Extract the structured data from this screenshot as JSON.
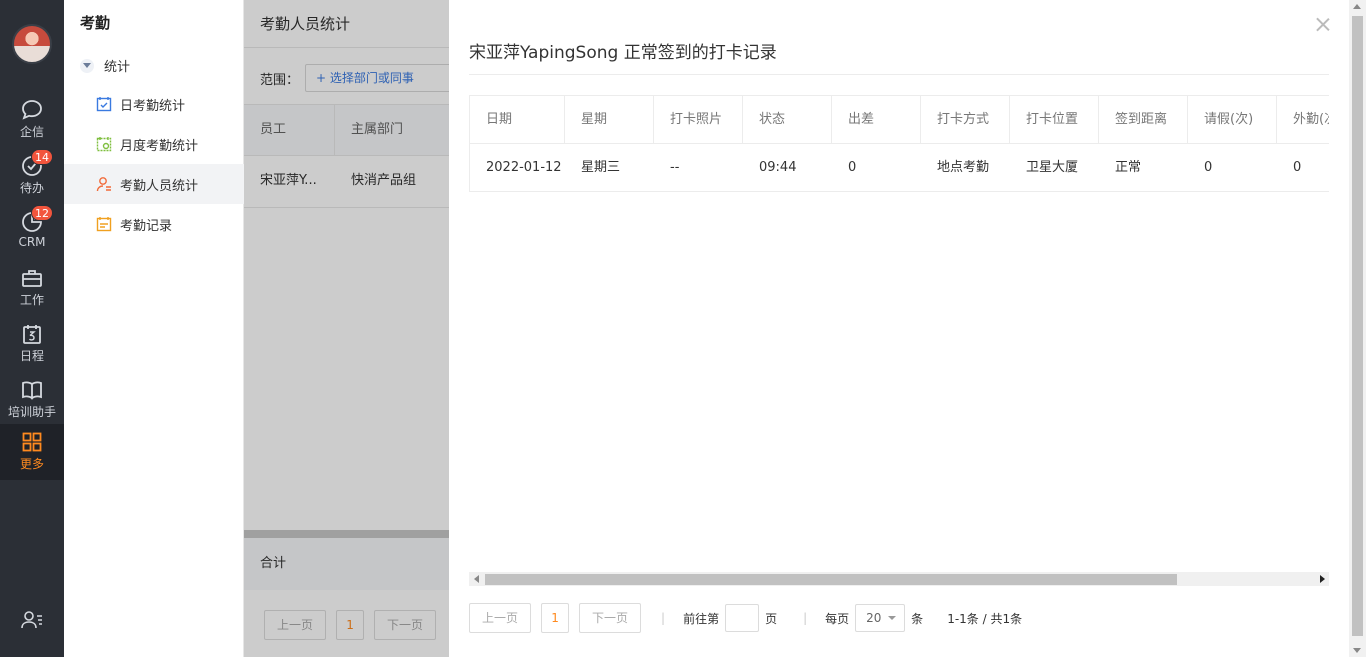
{
  "rail": {
    "items": [
      {
        "label": "企信"
      },
      {
        "label": "待办",
        "badge": "14"
      },
      {
        "label": "CRM",
        "badge": "12"
      },
      {
        "label": "工作"
      },
      {
        "label": "日程"
      },
      {
        "label": "培训助手"
      },
      {
        "label": "更多"
      }
    ]
  },
  "sidebar": {
    "title": "考勤",
    "group": "统计",
    "items": [
      {
        "label": "日考勤统计",
        "icon": "calendar-check-icon"
      },
      {
        "label": "月度考勤统计",
        "icon": "calendar-month-icon"
      },
      {
        "label": "考勤人员统计",
        "icon": "person-icon"
      },
      {
        "label": "考勤记录",
        "icon": "record-icon"
      }
    ]
  },
  "background": {
    "header": "考勤人员统计",
    "range_label": "范围：",
    "range_picker": "+ 选择部门或同事",
    "columns": [
      "员工",
      "主属部门"
    ],
    "row": [
      "宋亚萍Y...",
      "快消产品组"
    ],
    "total_label": "合计",
    "pager": {
      "prev": "上一页",
      "page": "1",
      "next": "下一页"
    }
  },
  "drawer": {
    "title": "宋亚萍YapingSong 正常签到的打卡记录",
    "columns": [
      "日期",
      "星期",
      "打卡照片",
      "状态",
      "出差",
      "打卡方式",
      "打卡位置",
      "签到距离",
      "请假(次)",
      "外勤(次)"
    ],
    "rows": [
      [
        "2022-01-12",
        "星期三",
        "--",
        "09:44",
        "0",
        "地点考勤",
        "卫星大厦",
        "正常",
        "0",
        "0"
      ]
    ],
    "pager": {
      "prev": "上一页",
      "page": "1",
      "next": "下一页",
      "goto_label": "前往第",
      "goto_value": "",
      "page_unit": "页",
      "per_page_label": "每页",
      "per_page_value": "20",
      "per_page_unit": "条",
      "summary": "1-1条 / 共1条"
    }
  },
  "colors": {
    "accent": "#ff8a1f",
    "rail_bg": "#2b2f36",
    "badge": "#f2553d",
    "link": "#3a7ae0"
  }
}
